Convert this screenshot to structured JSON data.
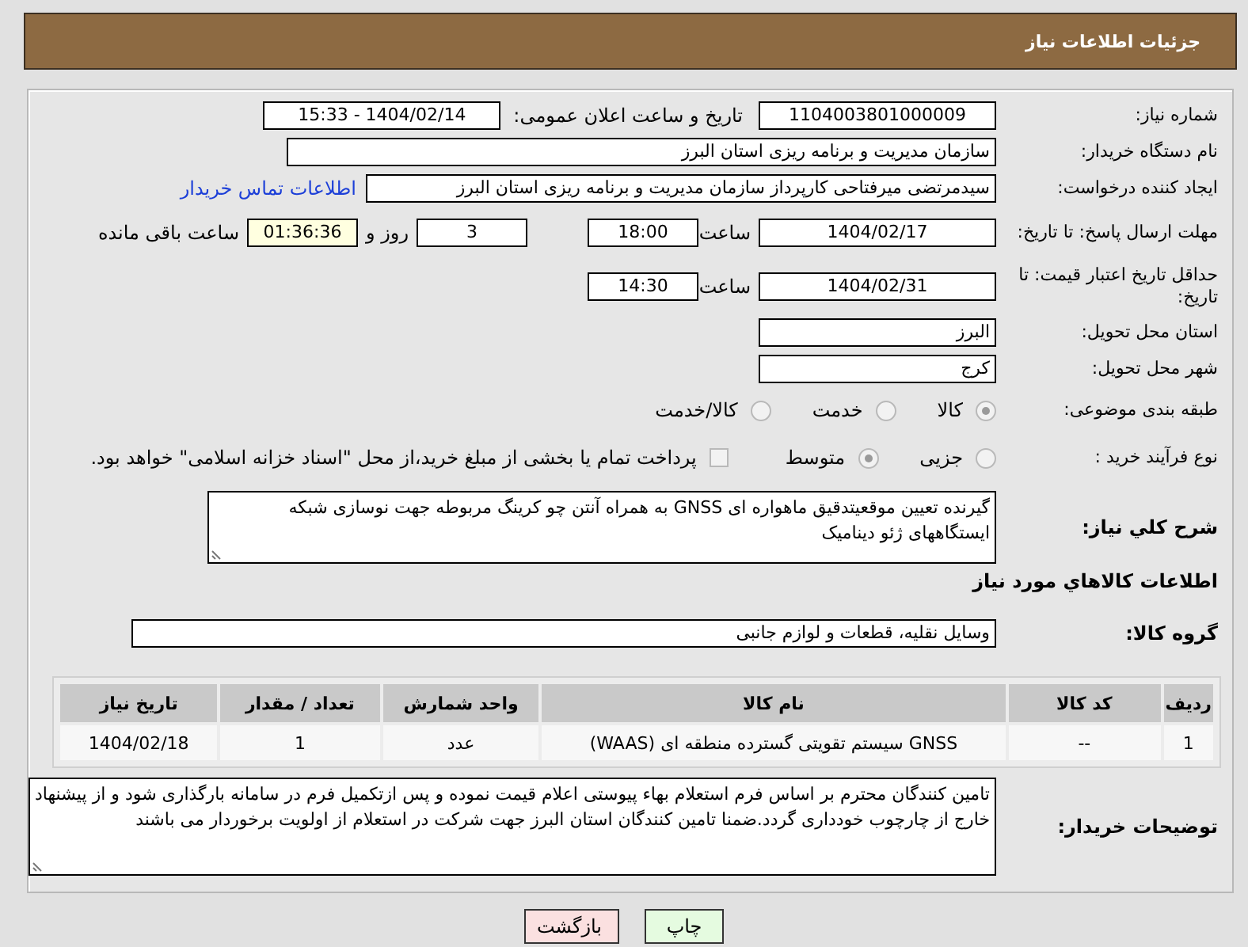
{
  "header": {
    "title": "جزئیات اطلاعات نیاز"
  },
  "need_number": {
    "label": "شماره نیاز:",
    "value": "1104003801000009"
  },
  "announce": {
    "label": "تاریخ و ساعت اعلان عمومی:",
    "value": "1404/02/14 - 15:33"
  },
  "buyer_org": {
    "label": "نام دستگاه خریدار:",
    "value": "سازمان مدیریت و برنامه ریزی استان البرز"
  },
  "requester": {
    "label": "ایجاد کننده درخواست:",
    "value": "سیدمرتضی میرفتاحی کارپرداز سازمان مدیریت و برنامه ریزی استان البرز",
    "link": "اطلاعات تماس خریدار"
  },
  "reply_deadline": {
    "label": "مهلت ارسال پاسخ: تا تاریخ:",
    "date": "1404/02/17",
    "time_label": "ساعت",
    "time": "18:00",
    "days": "3",
    "days_label": "روز و",
    "remaining": "01:36:36",
    "remaining_label": "ساعت باقی مانده"
  },
  "price_validity": {
    "label": "حداقل تاریخ اعتبار قیمت: تا تاریخ:",
    "date": "1404/02/31",
    "time_label": "ساعت",
    "time": "14:30"
  },
  "province": {
    "label": "استان محل تحویل:",
    "value": "البرز"
  },
  "city": {
    "label": "شهر محل تحویل:",
    "value": "کرج"
  },
  "category": {
    "label": "طبقه بندی موضوعی:",
    "options": [
      {
        "label": "کالا",
        "selected": true
      },
      {
        "label": "خدمت",
        "selected": false
      },
      {
        "label": "کالا/خدمت",
        "selected": false
      }
    ]
  },
  "process": {
    "label": "نوع فرآیند خرید :",
    "options": [
      {
        "label": "جزیی",
        "selected": false
      },
      {
        "label": "متوسط",
        "selected": true
      }
    ],
    "treasury": {
      "label": "پرداخت تمام یا بخشی از مبلغ خرید،از محل \"اسناد خزانه اسلامی\" خواهد بود.",
      "checked": false
    }
  },
  "description": {
    "label": "شرح کلي نیاز:",
    "value": "گیرنده تعیین موقعیتدقیق ماهواره ای GNSS به همراه آنتن چو کرینگ مربوطه جهت نوسازی شبکه ایستگاههای ژئو دینامیک"
  },
  "goods_heading": "اطلاعات کالاهاي مورد نياز",
  "goods_group": {
    "label": "گروه کالا:",
    "value": "وسایل نقلیه، قطعات و لوازم جانبی"
  },
  "table": {
    "columns": [
      "ردیف",
      "کد کالا",
      "نام کالا",
      "واحد شمارش",
      "تعداد / مقدار",
      "تاریخ نیاز"
    ],
    "rows": [
      [
        "1",
        "--",
        "GNSS سیستم تقویتی گسترده منطقه ای (WAAS)",
        "عدد",
        "1",
        "1404/02/18"
      ]
    ]
  },
  "buyer_notes": {
    "label": "توضیحات خریدار:",
    "value": "تامین کنندگان محترم بر اساس فرم استعلام بهاء پیوستی اعلام قیمت نموده و پس ازتکمیل فرم در سامانه بارگذاری شود و از پیشنهاد خارج از چارچوب خودداری گردد.ضمنا  تامین کنندگان استان البرز جهت شرکت در استعلام از اولویت برخوردار می باشند"
  },
  "buttons": [
    {
      "label": "چاپ",
      "kind": "print"
    },
    {
      "label": "بازگشت",
      "kind": "back"
    }
  ]
}
